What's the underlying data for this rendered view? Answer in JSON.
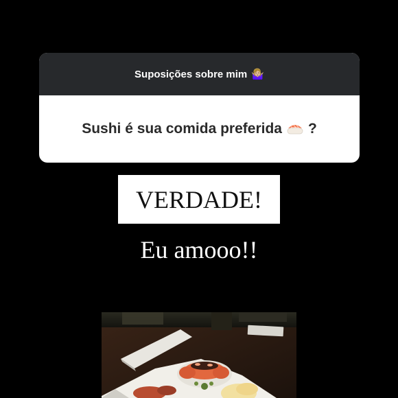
{
  "question_card": {
    "title": "Suposições sobre mim",
    "title_emoji": "🤷🏼‍♀️",
    "question": "Sushi é sua comida preferida",
    "question_suffix": "?"
  },
  "answer": {
    "label": "VERDADE!"
  },
  "caption": {
    "text": "Eu amooo!!"
  },
  "photo": {
    "icon": "sushi-photo"
  },
  "colors": {
    "background": "#000000",
    "card_header": "#27292c",
    "card_body": "#ffffff",
    "question_text": "#2a2a2a",
    "answer_box": "#ffffff",
    "answer_text": "#111111",
    "caption_text": "#ffffff"
  }
}
